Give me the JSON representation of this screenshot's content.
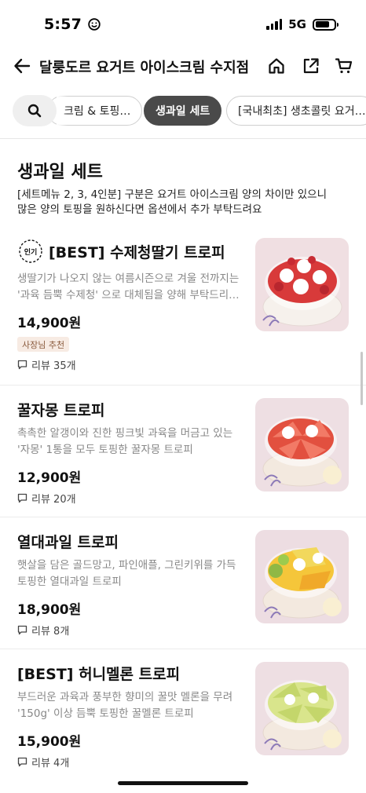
{
  "status_bar": {
    "time": "5:57",
    "network": "5G"
  },
  "header": {
    "title": "달룽도르 요거트 아이스크림 수지점"
  },
  "filters": {
    "chips": [
      {
        "label": "크림 & 토핑…"
      },
      {
        "label": "생과일 세트",
        "active": true
      },
      {
        "label": "[국내최초] 생초콜릿 요거…"
      }
    ]
  },
  "section": {
    "title": "생과일 세트",
    "desc_line1": "[세트메뉴 2, 3, 4인분] 구분은 요거트 아이스크림 양의 차이만 있으니",
    "desc_line2": "많은 양의 토핑을 원하신다면 옵션에서 추가 부탁드려요"
  },
  "items": [
    {
      "popular_badge": "인기",
      "title": "[BEST] 수제청딸기 트로피",
      "desc_line1": "생딸기가 나오지 않는 여름시즌으로 겨울 전까지는",
      "desc_line2": "'과육 듬뿍 수제청' 으로 대체됨을 양해 부탁드리…",
      "price": "14,900원",
      "badge": "사장님 추천",
      "review": "리뷰 35개",
      "image": "strawberry-yogurt-bowl"
    },
    {
      "title": "꿀자몽 트로피",
      "desc_line1": "촉촉한 알갱이와 진한 핑크빛 과육을 머금고 있는",
      "desc_line2": "'자몽' 1통을 모두 토핑한 꿀자몽 트로피",
      "price": "12,900원",
      "review": "리뷰 20개",
      "image": "grapefruit-yogurt-bowl"
    },
    {
      "title": "열대과일 트로피",
      "desc_line1": "햇살을 담은 골드망고, 파인애플, 그린키위를 가득",
      "desc_line2": "토핑한 열대과일 트로피",
      "price": "18,900원",
      "review": "리뷰 8개",
      "image": "tropical-fruit-yogurt-bowl"
    },
    {
      "title": "[BEST] 허니멜론 트로피",
      "desc_line1": "부드러운 과육과 풍부한 향미의 꿀맛 멜론을 무려",
      "desc_line2": "'150g' 이상 듬뿍 토핑한 꿀멜론 트로피",
      "price": "15,900원",
      "review": "리뷰 4개",
      "image": "honeydew-melon-yogurt-bowl"
    }
  ],
  "colors": {
    "accent_chip": "#4a4a4a",
    "badge_bg": "#f7ebe3",
    "badge_text": "#8a5a3d",
    "desc_gray": "#888888"
  }
}
